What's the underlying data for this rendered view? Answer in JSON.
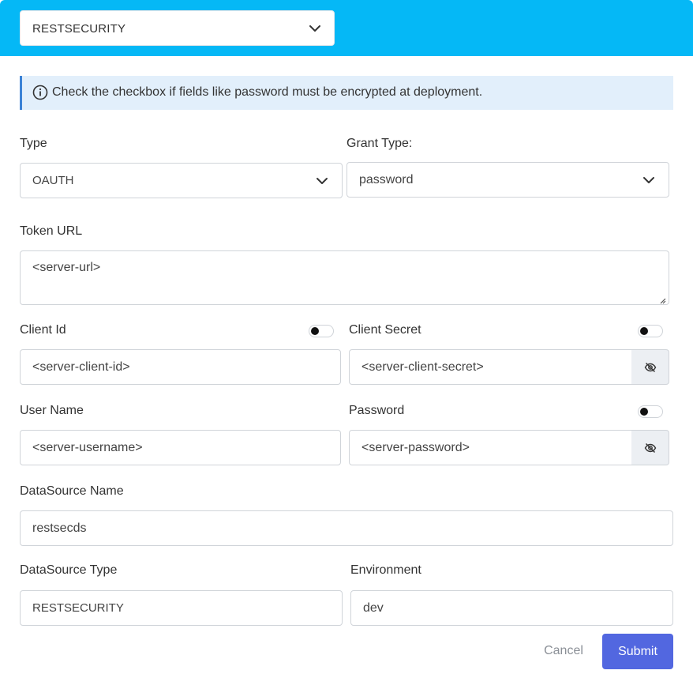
{
  "header": {
    "security_select_value": "RESTSECURITY"
  },
  "info": {
    "message": "Check the checkbox if fields like password must be encrypted at deployment."
  },
  "form": {
    "type_label": "Type",
    "type_value": "OAUTH",
    "grant_type_label": "Grant Type:",
    "grant_type_value": "password",
    "token_url_label": "Token URL",
    "token_url_value": "<server-url>",
    "client_id_label": "Client Id",
    "client_id_value": "<server-client-id>",
    "client_secret_label": "Client Secret",
    "client_secret_value": "<server-client-secret>",
    "user_name_label": "User Name",
    "user_name_value": "<server-username>",
    "password_label": "Password",
    "password_value": "<server-password>",
    "datasource_name_label": "DataSource Name",
    "datasource_name_value": "restsecds",
    "datasource_type_label": "DataSource Type",
    "datasource_type_value": "RESTSECURITY",
    "environment_label": "Environment",
    "environment_value": "dev"
  },
  "actions": {
    "cancel_label": "Cancel",
    "submit_label": "Submit"
  },
  "icons": {
    "info": "info-circle-icon",
    "chevron": "chevron-down-icon",
    "eye": "eye-off-icon"
  },
  "colors": {
    "header_bg": "#05b8f6",
    "info_bg": "#e2effb",
    "info_border": "#3b82d6",
    "submit_bg": "#5267e0"
  }
}
